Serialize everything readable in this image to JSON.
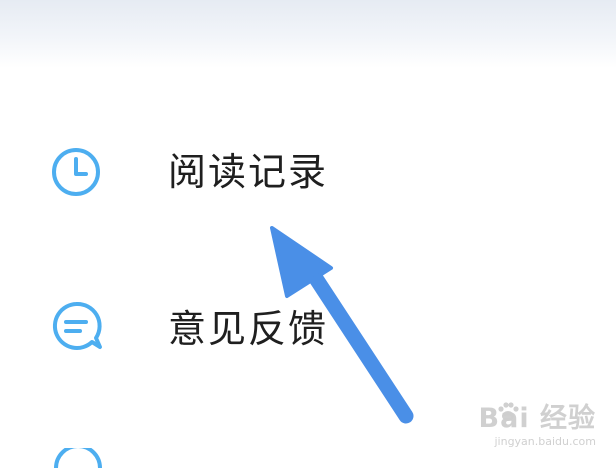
{
  "menu": {
    "items": [
      {
        "label": "阅读记录",
        "icon": "clock-icon"
      },
      {
        "label": "意见反馈",
        "icon": "chat-bubble-icon"
      }
    ]
  },
  "watermark": {
    "main": "Bai 经验",
    "url": "jingyan.baidu.com"
  },
  "colors": {
    "icon": "#4daef0",
    "arrow": "#4a8fe7",
    "label": "#1f1f1f",
    "header_fade": "#e6ebf3"
  }
}
